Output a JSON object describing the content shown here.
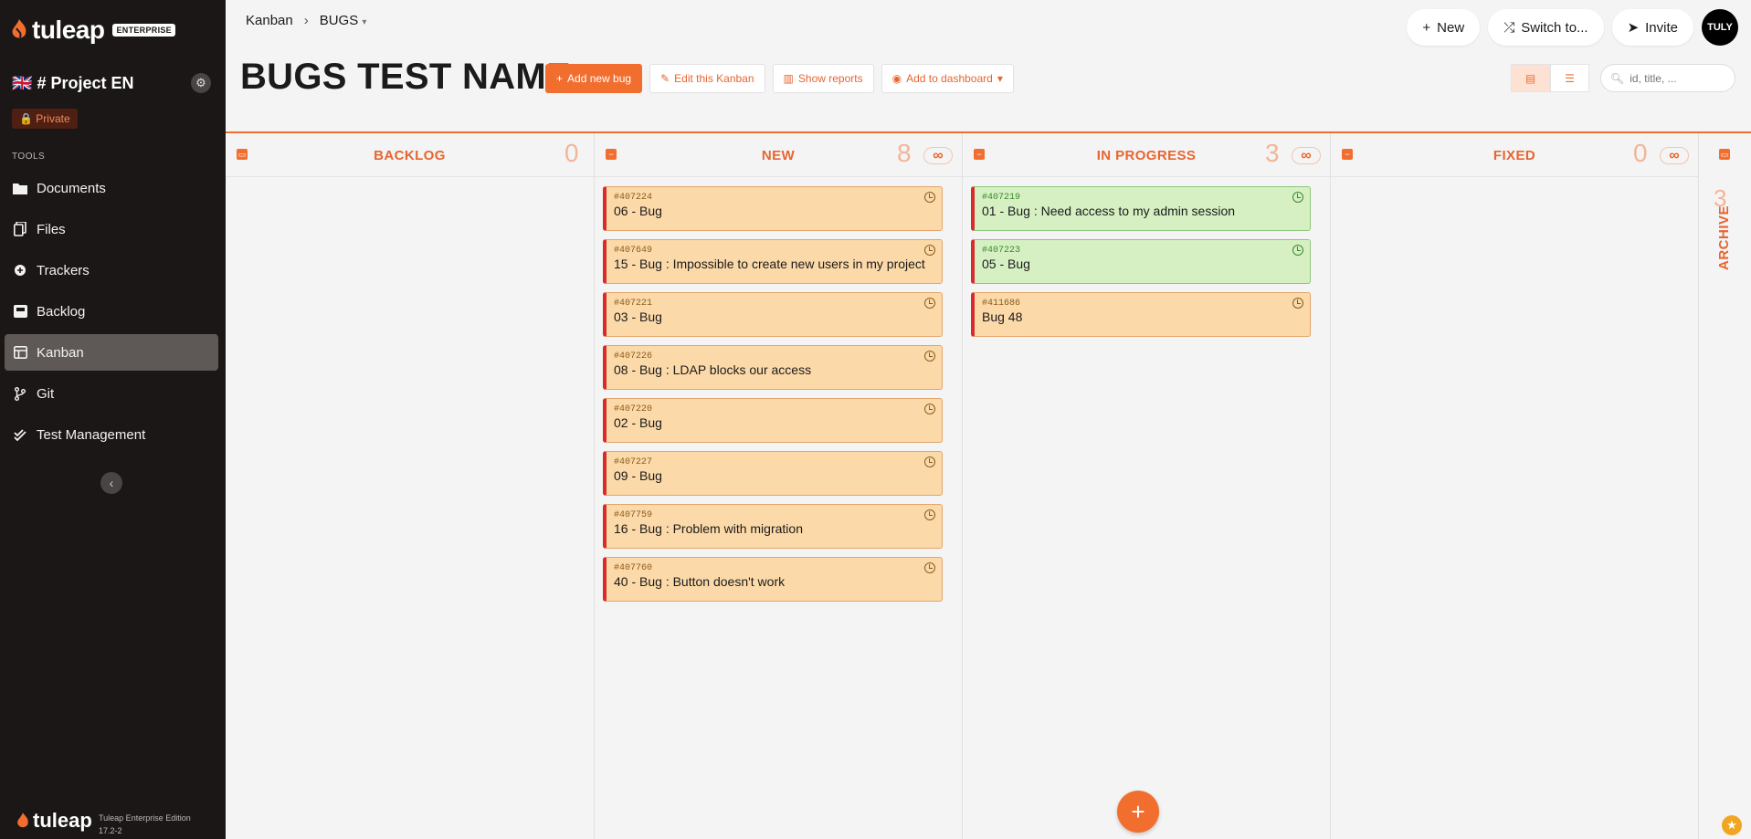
{
  "app": {
    "logo": "tuleap",
    "badge": "ENTERPRISE",
    "edition": "Tuleap Enterprise Edition",
    "version": "17.2-2"
  },
  "project": {
    "flag": "🇬🇧",
    "name": "# Project EN",
    "visibility": "Private"
  },
  "sidebar": {
    "tools_title": "TOOLS",
    "items": [
      {
        "label": "Documents",
        "icon": "folder-icon",
        "active": false
      },
      {
        "label": "Files",
        "icon": "files-icon",
        "active": false
      },
      {
        "label": "Trackers",
        "icon": "tracker-icon",
        "active": false
      },
      {
        "label": "Backlog",
        "icon": "backlog-icon",
        "active": false
      },
      {
        "label": "Kanban",
        "icon": "kanban-icon",
        "active": true
      },
      {
        "label": "Git",
        "icon": "git-icon",
        "active": false
      },
      {
        "label": "Test Management",
        "icon": "test-icon",
        "active": false
      }
    ]
  },
  "breadcrumb": {
    "first": "Kanban",
    "second": "BUGS"
  },
  "top_actions": {
    "new": "New",
    "switch": "Switch to...",
    "invite": "Invite",
    "avatar": "TULY"
  },
  "page": {
    "title": "BUGS TEST NAME"
  },
  "actions": {
    "add": "Add new bug",
    "edit": "Edit this Kanban",
    "reports": "Show reports",
    "dashboard": "Add to dashboard"
  },
  "search": {
    "placeholder": "id, title, ..."
  },
  "columns": {
    "backlog": {
      "label": "BACKLOG",
      "count": "0"
    },
    "new": {
      "label": "NEW",
      "count": "8",
      "limit": "∞"
    },
    "in_progress": {
      "label": "IN PROGRESS",
      "count": "3",
      "limit": "∞"
    },
    "fixed": {
      "label": "FIXED",
      "count": "0",
      "limit": "∞"
    },
    "archive": {
      "label": "ARCHIVE",
      "count": "3"
    }
  },
  "cards_new": [
    {
      "id": "#407224",
      "title": "06 - Bug"
    },
    {
      "id": "#407649",
      "title": "15 - Bug : Impossible to create new users in my project"
    },
    {
      "id": "#407221",
      "title": "03 - Bug"
    },
    {
      "id": "#407226",
      "title": "08 - Bug : LDAP blocks our access"
    },
    {
      "id": "#407220",
      "title": "02 - Bug"
    },
    {
      "id": "#407227",
      "title": "09 - Bug"
    },
    {
      "id": "#407759",
      "title": "16 - Bug : Problem with migration"
    },
    {
      "id": "#407760",
      "title": "40 - Bug : Button doesn't work"
    }
  ],
  "cards_progress": [
    {
      "id": "#407219",
      "title": "01 - Bug : Need access to my admin session",
      "color": "green"
    },
    {
      "id": "#407223",
      "title": "05 - Bug",
      "color": "green"
    },
    {
      "id": "#411686",
      "title": "Bug 48",
      "color": "orange"
    }
  ],
  "colors": {
    "accent": "#f26e2f",
    "sidebar": "#1b1716",
    "card_orange": "#fcd9a8",
    "card_green": "#d6f0c3"
  }
}
